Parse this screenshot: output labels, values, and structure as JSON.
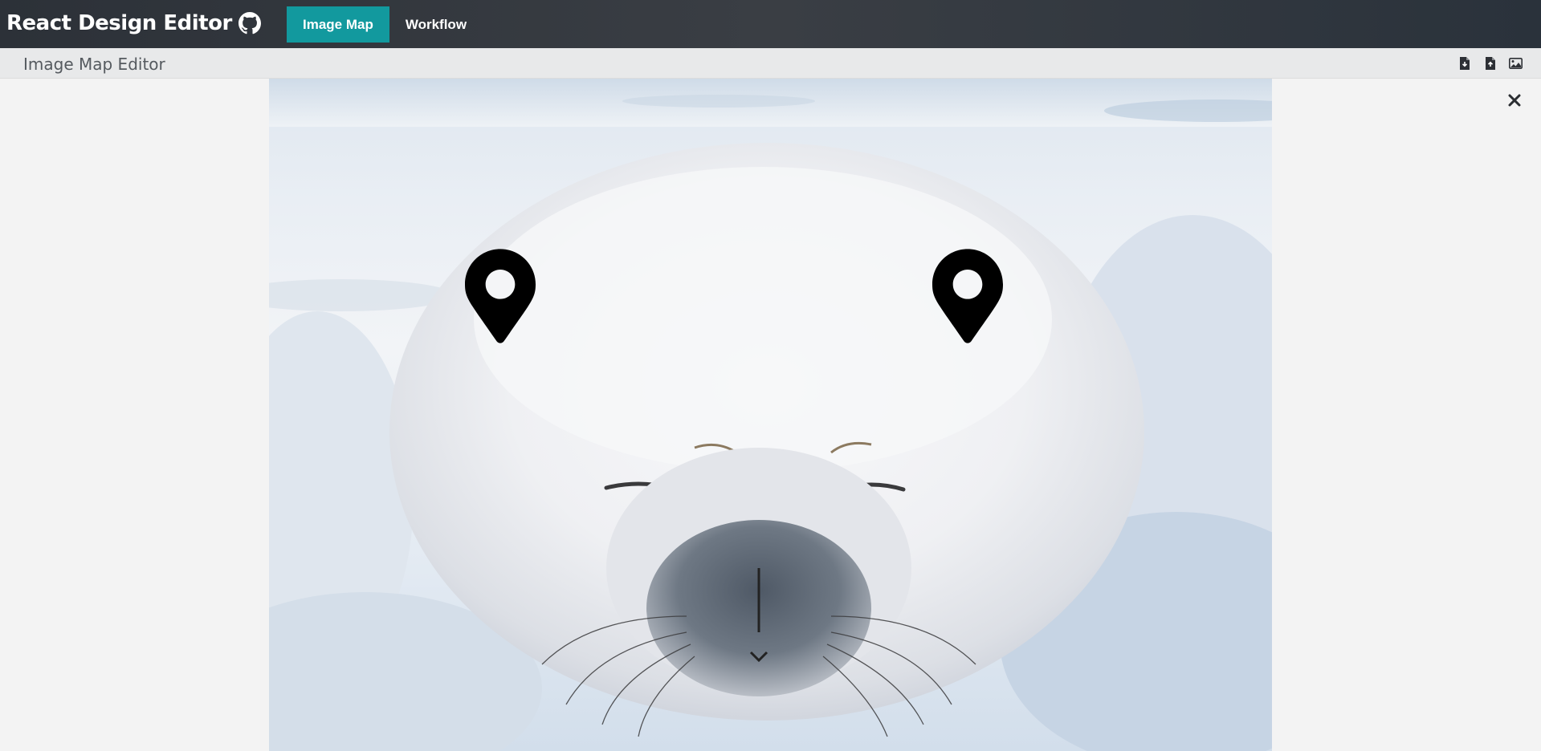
{
  "app": {
    "title": "React Design Editor",
    "github_icon": "github-icon"
  },
  "nav": {
    "items": [
      {
        "label": "Image Map",
        "active": true
      },
      {
        "label": "Workflow",
        "active": false
      }
    ]
  },
  "subheader": {
    "title": "Image Map Editor",
    "tools": [
      "file-download-icon",
      "file-upload-icon",
      "image-icon"
    ]
  },
  "canvas": {
    "image_subject": "harp seal pup on snow",
    "markers": [
      "map-marker-icon",
      "map-marker-icon"
    ],
    "close_icon": "close-icon"
  },
  "colors": {
    "topbar": "#2c3138",
    "accent": "#12999e",
    "subbar": "#e8e9ea",
    "background": "#f3f3f3"
  }
}
